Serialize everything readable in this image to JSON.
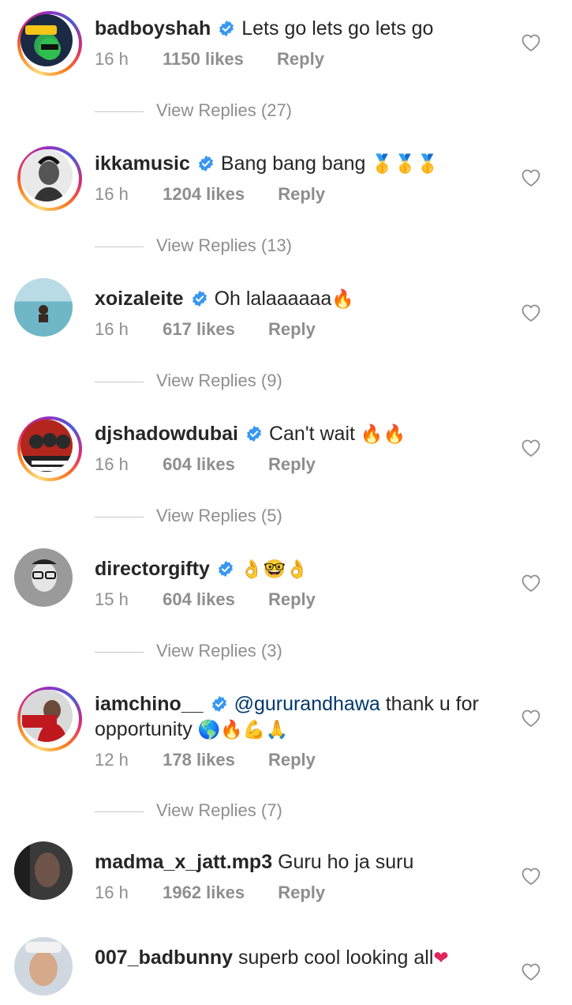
{
  "comments": [
    {
      "username": "badboyshah",
      "verified": true,
      "text": "Lets go lets go lets go",
      "emoji": "",
      "time": "16 h",
      "likes": "1150 likes",
      "reply": "Reply",
      "view_replies": "View Replies (27)"
    },
    {
      "username": "ikkamusic",
      "verified": true,
      "text": "Bang bang bang",
      "emoji": "🥇🥇🥇",
      "time": "16 h",
      "likes": "1204 likes",
      "reply": "Reply",
      "view_replies": "View Replies (13)"
    },
    {
      "username": "xoizaleite",
      "verified": true,
      "text": "Oh lalaaaaaa",
      "emoji": "🔥",
      "time": "16 h",
      "likes": "617 likes",
      "reply": "Reply",
      "view_replies": "View Replies (9)"
    },
    {
      "username": "djshadowdubai",
      "verified": true,
      "text": "Can't wait",
      "emoji": "🔥🔥",
      "time": "16 h",
      "likes": "604 likes",
      "reply": "Reply",
      "view_replies": "View Replies (5)"
    },
    {
      "username": "directorgifty",
      "verified": true,
      "text": "",
      "emoji": "👌🤓👌",
      "time": "15 h",
      "likes": "604 likes",
      "reply": "Reply",
      "view_replies": "View Replies (3)"
    },
    {
      "username": "iamchino__",
      "verified": true,
      "mention": "@gururandhawa",
      "text": "thank u for opportunity",
      "emoji": "🌎🔥💪🙏",
      "time": "12 h",
      "likes": "178 likes",
      "reply": "Reply",
      "view_replies": "View Replies (7)"
    },
    {
      "username": "madma_x_jatt.mp3",
      "verified": false,
      "text": "Guru ho ja suru",
      "emoji": "",
      "time": "16 h",
      "likes": "1962 likes",
      "reply": "Reply"
    },
    {
      "username": "007_badbunny",
      "verified": false,
      "text": "superb cool looking all",
      "emoji": "❤"
    }
  ],
  "icons": {
    "verified": "verified-badge-icon",
    "like": "heart-outline-icon"
  },
  "colors": {
    "verified": "#3897f0",
    "text": "#262626",
    "secondary": "#8e8e8e",
    "mention": "#00376b"
  }
}
